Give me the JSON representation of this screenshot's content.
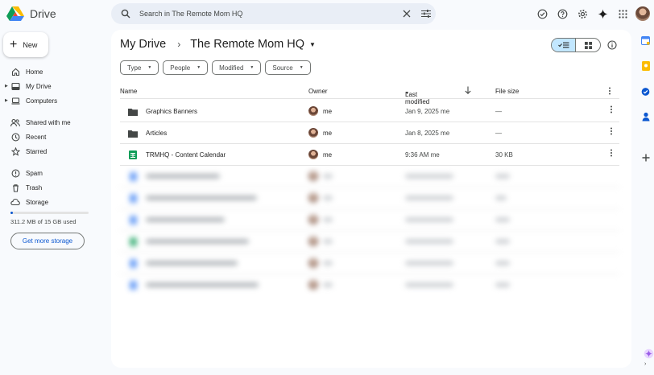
{
  "app": {
    "name": "Drive"
  },
  "search": {
    "placeholder": "Search in The Remote Mom HQ"
  },
  "sidebar": {
    "new_label": "New",
    "items": [
      {
        "label": "Home",
        "icon": "home-icon"
      },
      {
        "label": "My Drive",
        "icon": "my-drive-icon"
      },
      {
        "label": "Computers",
        "icon": "computers-icon"
      },
      {
        "label": "Shared with me",
        "icon": "shared-icon"
      },
      {
        "label": "Recent",
        "icon": "clock-icon"
      },
      {
        "label": "Starred",
        "icon": "star-icon"
      },
      {
        "label": "Spam",
        "icon": "spam-icon"
      },
      {
        "label": "Trash",
        "icon": "trash-icon"
      },
      {
        "label": "Storage",
        "icon": "cloud-icon"
      }
    ],
    "storage_used_text": "311.2 MB of 15 GB used",
    "storage_fraction": 0.02,
    "get_storage_label": "Get more storage"
  },
  "breadcrumb": {
    "parent": "My Drive",
    "current": "The Remote Mom HQ"
  },
  "filters": [
    "Type",
    "People",
    "Modified",
    "Source"
  ],
  "table": {
    "headers": {
      "name": "Name",
      "owner": "Owner",
      "modified": "Last modified",
      "size": "File size"
    },
    "rows": [
      {
        "name": "Graphics Banners",
        "type": "folder",
        "owner": "me",
        "modified": "Jan 9, 2025 me",
        "size": "—"
      },
      {
        "name": "Articles",
        "type": "folder",
        "owner": "me",
        "modified": "Jan 8, 2025 me",
        "size": "—"
      },
      {
        "name": "TRMHQ - Content Calendar",
        "type": "sheet",
        "owner": "me",
        "modified": "9:36 AM me",
        "size": "30 KB"
      }
    ]
  },
  "colors": {
    "accent": "#0b57d0",
    "toggle_active": "#c2e7ff",
    "doc_blue": "#4285f4",
    "sheet_green": "#0f9d58"
  }
}
